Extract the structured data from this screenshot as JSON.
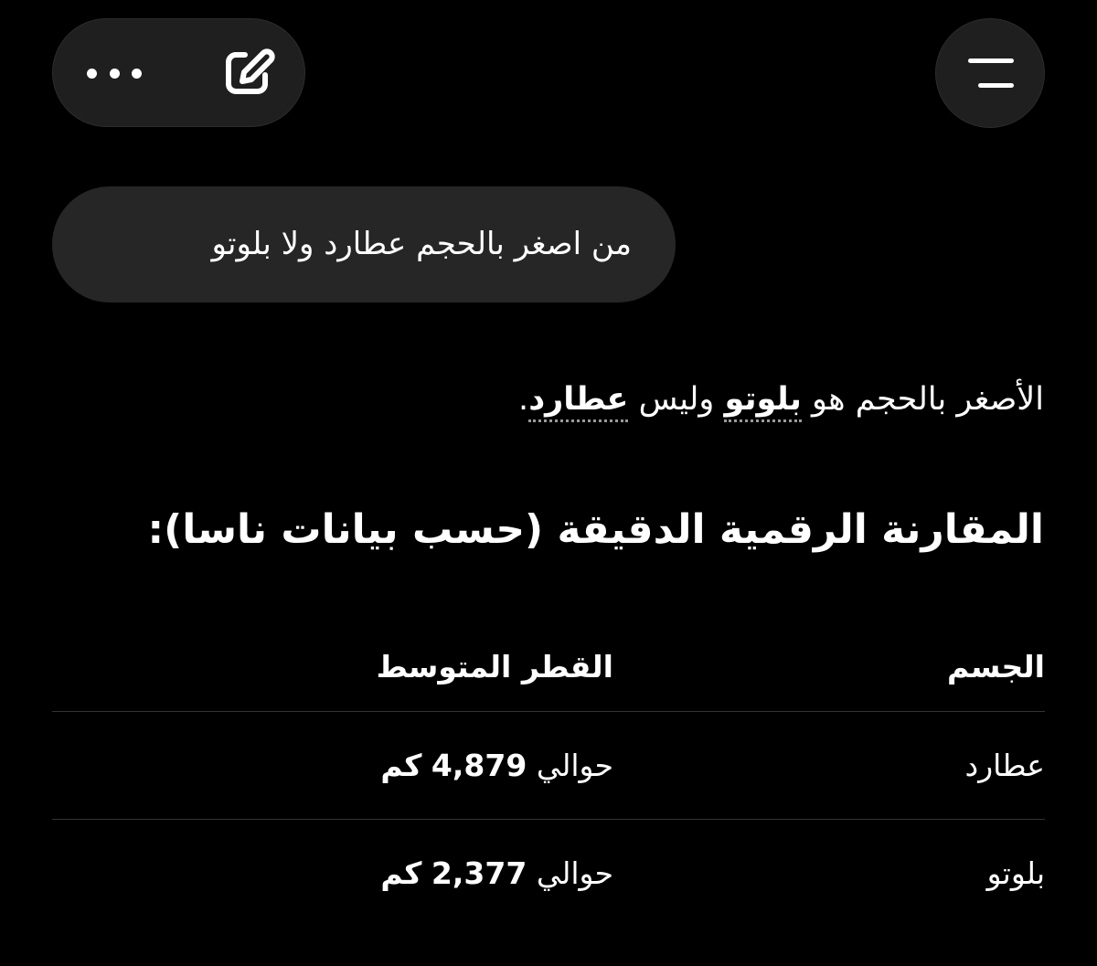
{
  "toolbar": {
    "more_icon": "ellipsis-icon",
    "edit_icon": "edit-square-icon",
    "menu_icon": "menu-icon"
  },
  "conversation": {
    "user_message": "من اصغر بالحجم عطارد ولا بلوتو",
    "answer": {
      "prefix": "الأصغر بالحجم هو ",
      "smaller": "بلوتو",
      "middle": " وليس ",
      "larger": "عطارد",
      "suffix": "."
    },
    "heading": "المقارنة الرقمية الدقيقة (حسب بيانات ناسا):"
  },
  "table": {
    "headers": [
      "الجسم",
      "القطر المتوسط"
    ],
    "rows": [
      {
        "body": "عطارد",
        "prefix": "حوالي",
        "value": "4,879",
        "unit": "كم"
      },
      {
        "body": "بلوتو",
        "prefix": "حوالي",
        "value": "2,377",
        "unit": "كم"
      }
    ]
  },
  "colors": {
    "background": "#000000",
    "surface": "#1f1f1f",
    "bubble": "#262626",
    "text": "#ffffff"
  }
}
